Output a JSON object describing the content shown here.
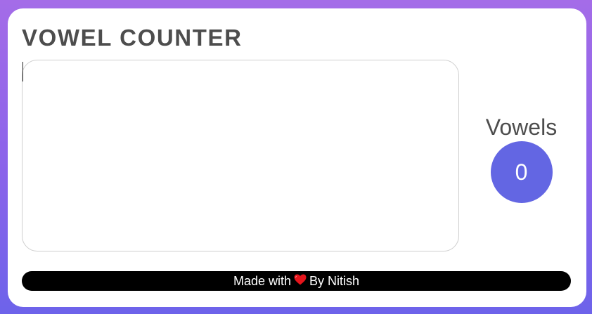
{
  "app": {
    "title": "VOWEL COUNTER"
  },
  "editor": {
    "value": "",
    "placeholder": ""
  },
  "counter": {
    "label": "Vowels",
    "value": "0"
  },
  "footer": {
    "prefix": "Made with",
    "icon": "heart-icon",
    "suffix": "By Nitish"
  },
  "colors": {
    "accent": "#6366e3",
    "heart": "#e5141b",
    "title": "#4d4d4d",
    "background_top": "#a46ce8",
    "background_bottom": "#6d63ea"
  }
}
